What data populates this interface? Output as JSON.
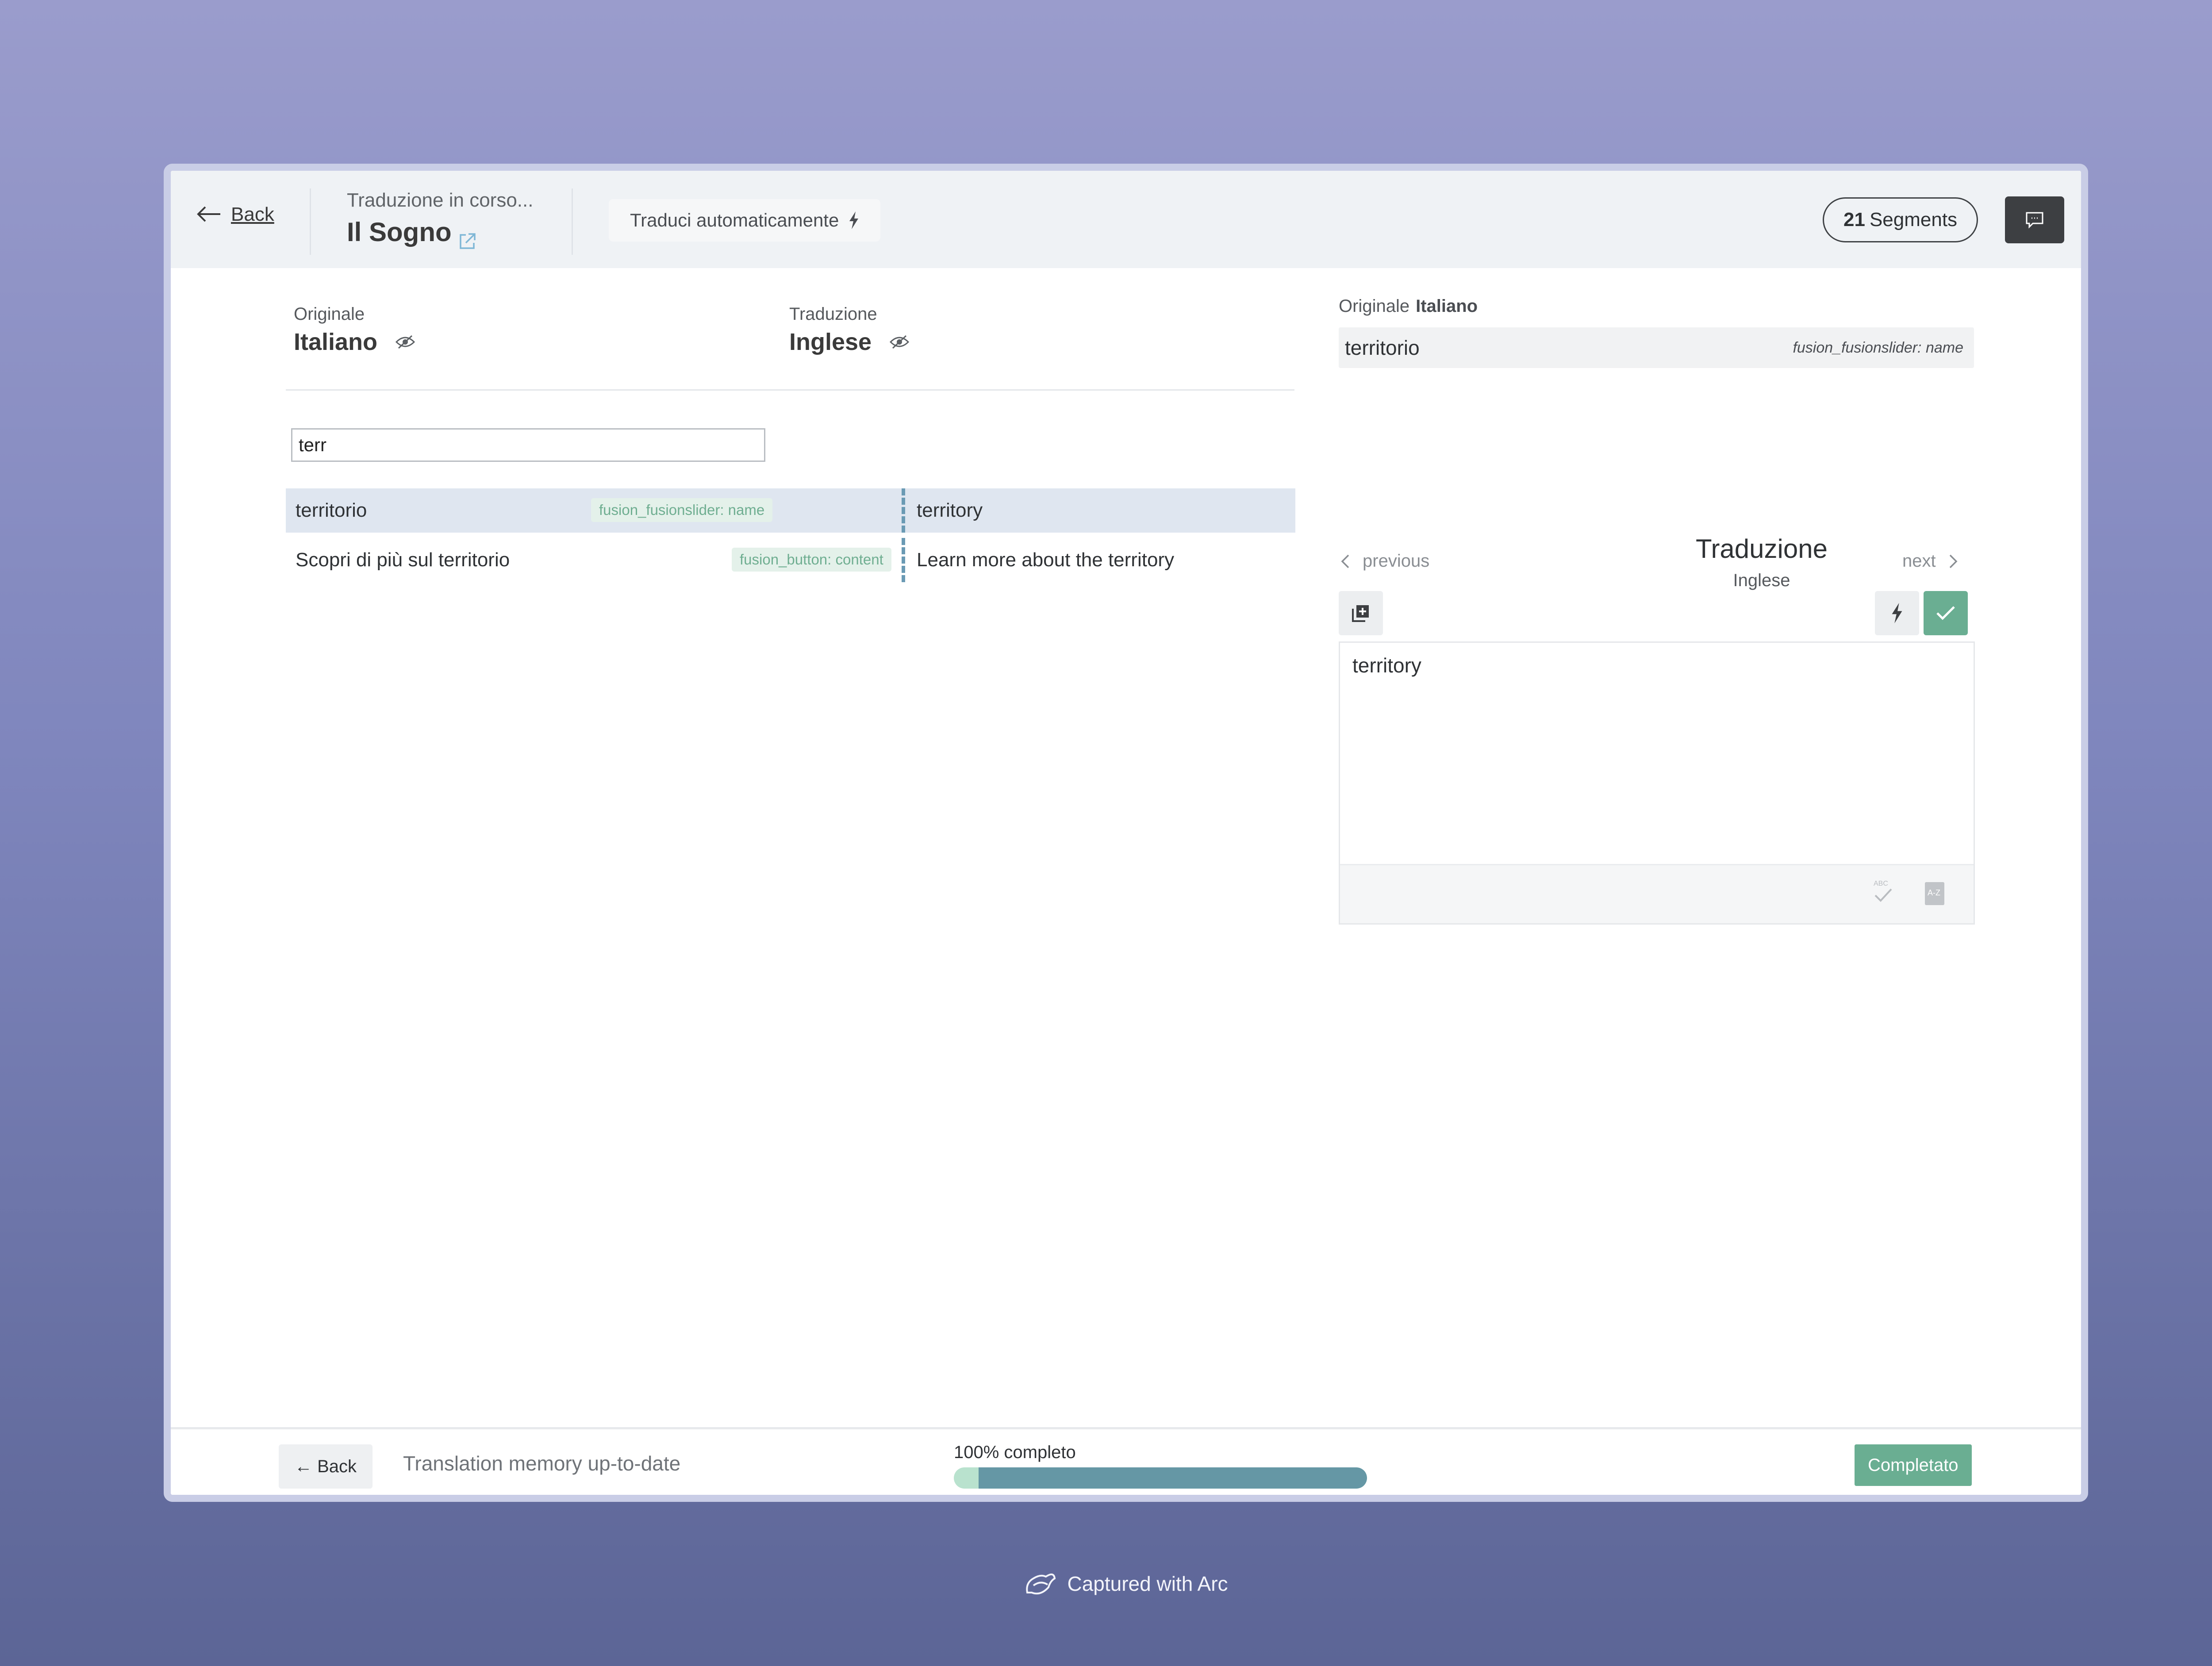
{
  "header": {
    "back_label": "Back",
    "subtitle": "Traduzione in corso...",
    "title": "Il Sogno",
    "auto_translate_label": "Traduci automaticamente",
    "segments_count": "21",
    "segments_label": "Segments"
  },
  "languages": {
    "source_label": "Originale",
    "source_name": "Italiano",
    "target_label": "Traduzione",
    "target_name": "Inglese"
  },
  "search": {
    "value": "terr",
    "placeholder": ""
  },
  "segments": [
    {
      "source": "territorio",
      "tag": "fusion_fusionslider: name",
      "target": "territory",
      "selected": true
    },
    {
      "source": "Scopri di più sul territorio",
      "tag": "fusion_button: content",
      "target": "Learn more about the territory",
      "selected": false
    }
  ],
  "right_panel": {
    "orig_label": "Originale",
    "orig_lang": "Italiano",
    "orig_text": "territorio",
    "orig_tag": "fusion_fusionslider: name",
    "prev_label": "previous",
    "next_label": "next",
    "translation_title": "Traduzione",
    "translation_lang": "Inglese",
    "editor_text": "territory"
  },
  "footer": {
    "back_label": "← Back",
    "status": "Translation memory up-to-date",
    "progress_label": "100% completo",
    "progress_value": 1.0,
    "complete_label": "Completato"
  },
  "credit": "Captured with Arc",
  "colors": {
    "accent_green": "#6aae92",
    "selected_row": "#dfe6f0",
    "progress_fill": "#6597a5",
    "progress_track": "#b9e2ce"
  },
  "icons": [
    "back-arrow-icon",
    "external-link-icon",
    "lightning-icon",
    "chat-icon",
    "eye-slash-icon",
    "chevron-left-icon",
    "chevron-right-icon",
    "copy-source-icon",
    "check-icon",
    "spellcheck-icon",
    "glossary-icon",
    "arc-logo-icon"
  ]
}
